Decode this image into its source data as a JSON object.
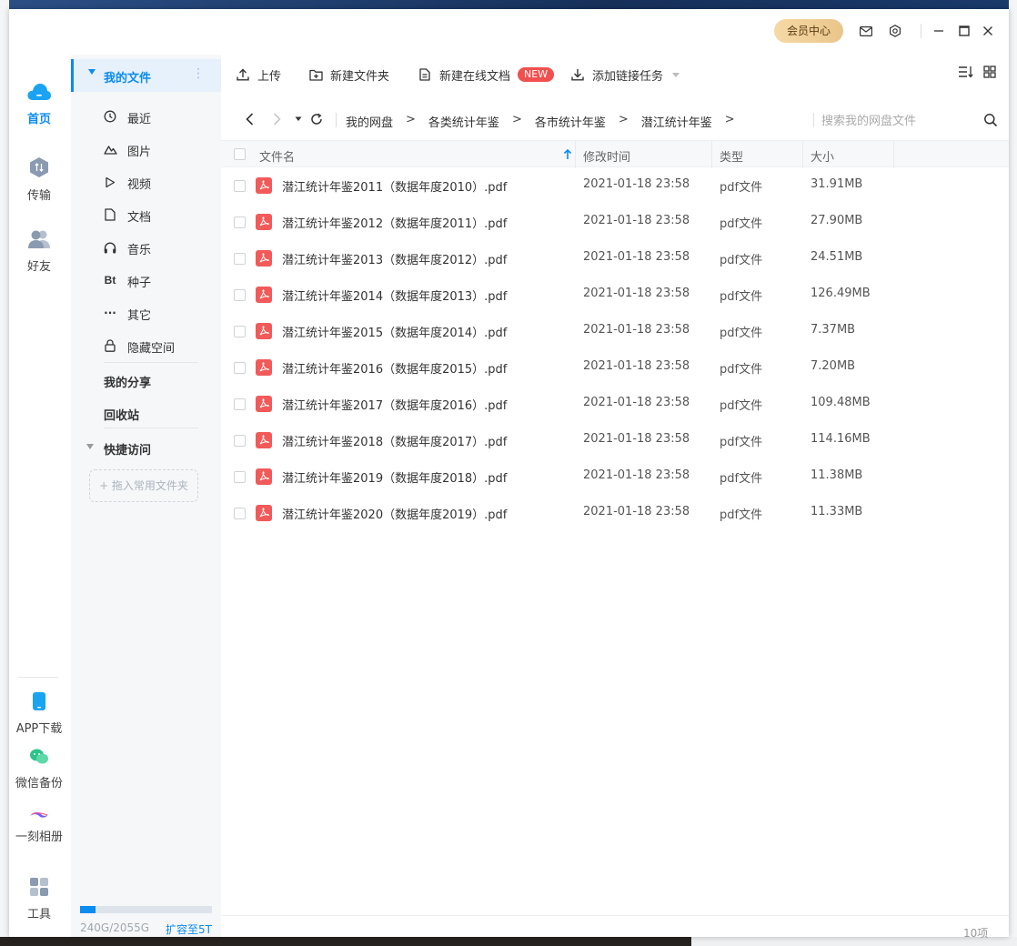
{
  "titlebar": {
    "vip_label": "会员中心"
  },
  "leftnav": {
    "items": [
      {
        "label": "首页",
        "icon": "cloud-icon"
      },
      {
        "label": "传输",
        "icon": "transfer-icon"
      },
      {
        "label": "好友",
        "icon": "friends-icon"
      },
      {
        "label": "APP下载",
        "icon": "phone-icon"
      },
      {
        "label": "微信备份",
        "icon": "wechat-icon"
      },
      {
        "label": "一刻相册",
        "icon": "album-icon"
      },
      {
        "label": "工具",
        "icon": "tools-icon"
      }
    ]
  },
  "sidebar": {
    "my_files": "我的文件",
    "items": [
      {
        "label": "最近",
        "icon": "clock-icon"
      },
      {
        "label": "图片",
        "icon": "image-icon"
      },
      {
        "label": "视频",
        "icon": "video-icon"
      },
      {
        "label": "文档",
        "icon": "document-icon"
      },
      {
        "label": "音乐",
        "icon": "headphones-icon"
      },
      {
        "label": "种子",
        "icon": "bt-icon",
        "glyph": "Bt"
      },
      {
        "label": "其它",
        "icon": "more-icon",
        "glyph": "···"
      },
      {
        "label": "隐藏空间",
        "icon": "lock-icon"
      }
    ],
    "my_share": "我的分享",
    "recycle": "回收站",
    "quick_access": "快捷访问",
    "add_folder": "+ 拖入常用文件夹",
    "storage_text": "240G/2055G",
    "storage_used_fraction": 0.117,
    "expand_label": "扩容至5T"
  },
  "toolbar": {
    "upload": "上传",
    "new_folder": "新建文件夹",
    "new_doc": "新建在线文档",
    "new_badge": "NEW",
    "add_link": "添加链接任务"
  },
  "breadcrumb": [
    "我的网盘",
    "各类统计年鉴",
    "各市统计年鉴",
    "潜江统计年鉴"
  ],
  "breadcrumb_sep": ">",
  "search": {
    "placeholder": "搜索我的网盘文件"
  },
  "table": {
    "headers": {
      "name": "文件名",
      "modified": "修改时间",
      "type": "类型",
      "size": "大小"
    },
    "rows": [
      {
        "name": "潜江统计年鉴2011（数据年度2010）.pdf",
        "modified": "2021-01-18 23:58",
        "type": "pdf文件",
        "size": "31.91MB"
      },
      {
        "name": "潜江统计年鉴2012（数据年度2011）.pdf",
        "modified": "2021-01-18 23:58",
        "type": "pdf文件",
        "size": "27.90MB"
      },
      {
        "name": "潜江统计年鉴2013（数据年度2012）.pdf",
        "modified": "2021-01-18 23:58",
        "type": "pdf文件",
        "size": "24.51MB"
      },
      {
        "name": "潜江统计年鉴2014（数据年度2013）.pdf",
        "modified": "2021-01-18 23:58",
        "type": "pdf文件",
        "size": "126.49MB"
      },
      {
        "name": "潜江统计年鉴2015（数据年度2014）.pdf",
        "modified": "2021-01-18 23:58",
        "type": "pdf文件",
        "size": "7.37MB"
      },
      {
        "name": "潜江统计年鉴2016（数据年度2015）.pdf",
        "modified": "2021-01-18 23:58",
        "type": "pdf文件",
        "size": "7.20MB"
      },
      {
        "name": "潜江统计年鉴2017（数据年度2016）.pdf",
        "modified": "2021-01-18 23:58",
        "type": "pdf文件",
        "size": "109.48MB"
      },
      {
        "name": "潜江统计年鉴2018（数据年度2017）.pdf",
        "modified": "2021-01-18 23:58",
        "type": "pdf文件",
        "size": "114.16MB"
      },
      {
        "name": "潜江统计年鉴2019（数据年度2018）.pdf",
        "modified": "2021-01-18 23:58",
        "type": "pdf文件",
        "size": "11.38MB"
      },
      {
        "name": "潜江统计年鉴2020（数据年度2019）.pdf",
        "modified": "2021-01-18 23:58",
        "type": "pdf文件",
        "size": "11.33MB"
      }
    ]
  },
  "footer": {
    "count": "10项"
  },
  "colors": {
    "accent": "#0a8cf0",
    "pdf": "#f25a5a",
    "badge": "#f0504f"
  }
}
